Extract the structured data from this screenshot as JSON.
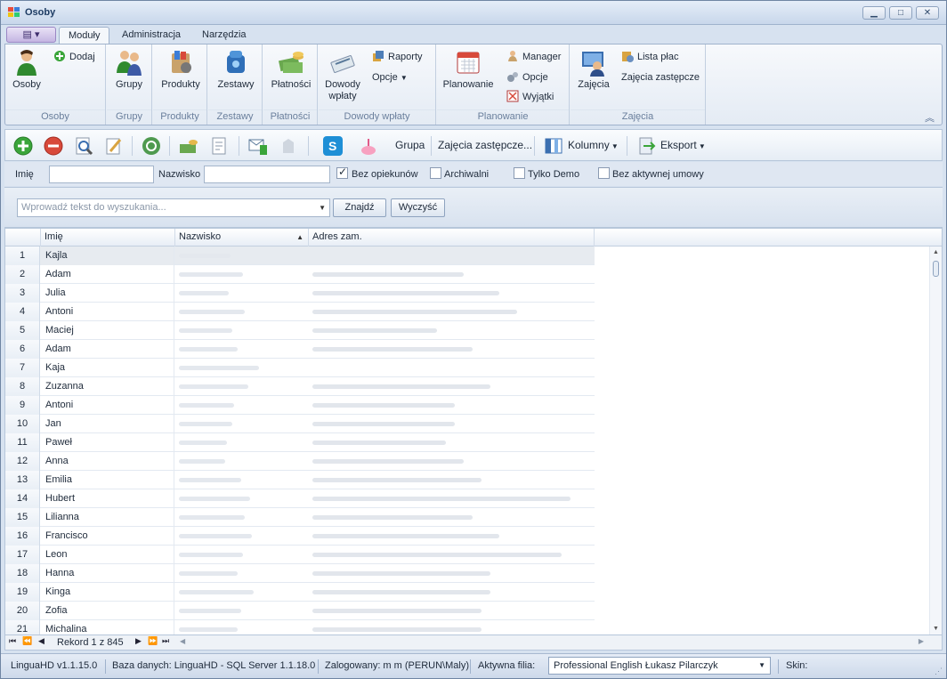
{
  "window": {
    "title": "Osoby",
    "controls": {
      "minimize": "▁",
      "maximize": "□",
      "close": "✕"
    }
  },
  "ribbon_tabs": [
    {
      "label": "Moduły",
      "active": true
    },
    {
      "label": "Administracja",
      "active": false
    },
    {
      "label": "Narzędzia",
      "active": false
    }
  ],
  "ribbon": {
    "osoby": {
      "label": "Osoby",
      "big": "Osoby",
      "add": "Dodaj"
    },
    "grupy": {
      "label": "Grupy",
      "big": "Grupy"
    },
    "produkty": {
      "label": "Produkty",
      "big": "Produkty"
    },
    "zestawy": {
      "label": "Zestawy",
      "big": "Zestawy"
    },
    "platnosci": {
      "label": "Płatności",
      "big": "Płatności"
    },
    "dowody": {
      "label": "Dowody wpłaty",
      "big_line1": "Dowody",
      "big_line2": "wpłaty",
      "raporty": "Raporty",
      "opcje": "Opcje"
    },
    "planowanie": {
      "label": "Planowanie",
      "big": "Planowanie",
      "manager": "Manager",
      "opcje": "Opcje",
      "wyjatki": "Wyjątki"
    },
    "zajecia": {
      "label": "Zajęcia",
      "big": "Zajęcia",
      "lista_plac": "Lista płac",
      "zastepcze": "Zajęcia zastępcze"
    }
  },
  "toolbar": {
    "grupa": "Grupa",
    "zastepcze": "Zajęcia zastępcze...",
    "kolumny": "Kolumny",
    "eksport": "Eksport"
  },
  "filters": {
    "imie_label": "Imię",
    "nazwisko_label": "Nazwisko",
    "bez_opiekunow": {
      "label": "Bez opiekunów",
      "checked": true
    },
    "archiwalni": {
      "label": "Archiwalni",
      "checked": false
    },
    "tylko_demo": {
      "label": "Tylko Demo",
      "checked": false
    },
    "bez_umowy": {
      "label": "Bez aktywnej umowy",
      "checked": false
    }
  },
  "search": {
    "placeholder": "Wprowadź tekst do wyszukania...",
    "find": "Znajdź",
    "clear": "Wyczyść"
  },
  "grid": {
    "columns": [
      "Imię",
      "Nazwisko",
      "Adres zam."
    ],
    "rows": [
      {
        "n": "1",
        "first": "Kajla"
      },
      {
        "n": "2",
        "first": "Adam"
      },
      {
        "n": "3",
        "first": "Julia"
      },
      {
        "n": "4",
        "first": "Antoni"
      },
      {
        "n": "5",
        "first": "Maciej"
      },
      {
        "n": "6",
        "first": "Adam"
      },
      {
        "n": "7",
        "first": "Kaja"
      },
      {
        "n": "8",
        "first": "Zuzanna"
      },
      {
        "n": "9",
        "first": "Antoni"
      },
      {
        "n": "10",
        "first": "Jan"
      },
      {
        "n": "11",
        "first": "Paweł"
      },
      {
        "n": "12",
        "first": "Anna"
      },
      {
        "n": "13",
        "first": "Emilia"
      },
      {
        "n": "14",
        "first": "Hubert"
      },
      {
        "n": "15",
        "first": "Lilianna"
      },
      {
        "n": "16",
        "first": "Francisco"
      },
      {
        "n": "17",
        "first": "Leon"
      },
      {
        "n": "18",
        "first": "Hanna"
      },
      {
        "n": "19",
        "first": "Kinga"
      },
      {
        "n": "20",
        "first": "Zofia"
      },
      {
        "n": "21",
        "first": "Michalina"
      }
    ]
  },
  "navigator": {
    "record": "Rekord 1 z 845"
  },
  "status": {
    "version": "LinguaHD v1.1.15.0",
    "db": "Baza danych: LinguaHD - SQL Server 1.1.18.0",
    "logged": "Zalogowany: m m (PERUN\\Maly)",
    "branch_label": "Aktywna filia:",
    "branch_value": "Professional English Łukasz Pilarczyk",
    "skin": "Skin:"
  }
}
